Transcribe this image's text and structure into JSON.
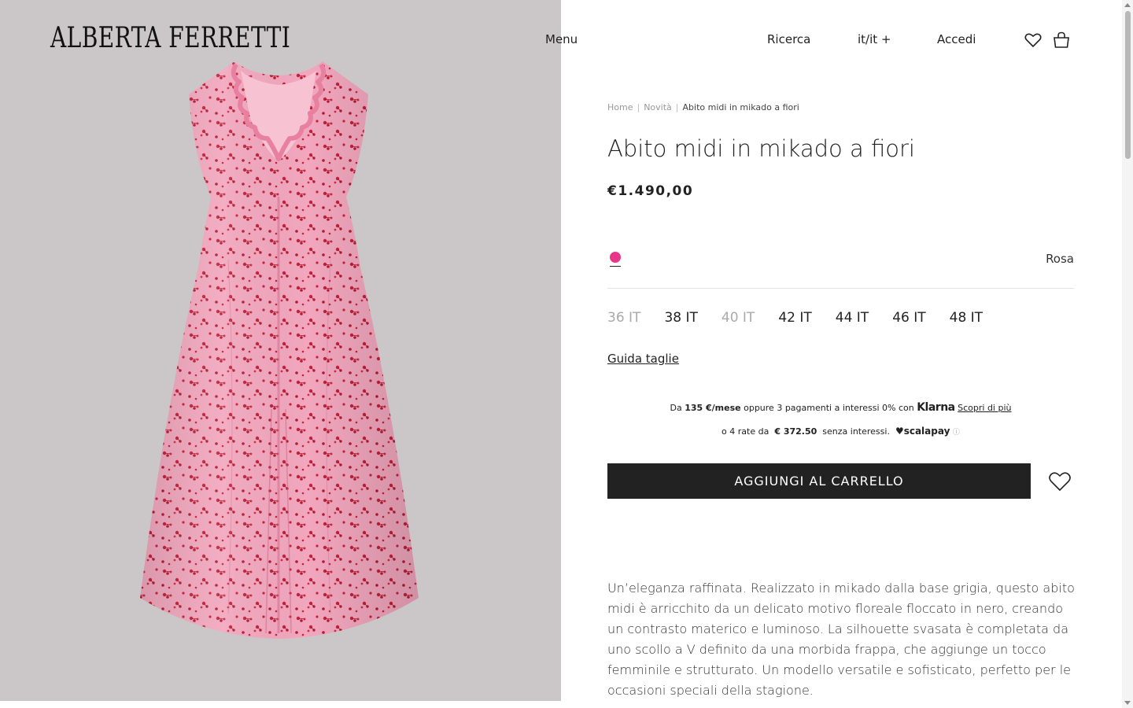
{
  "header": {
    "brand": "ALBERTA FERRETTI",
    "menu_label": "Menu",
    "search_label": "Ricerca",
    "locale_label": "it/it +",
    "login_label": "Accedi"
  },
  "breadcrumb": {
    "home": "Home",
    "category": "Novità",
    "current": "Abito midi in mikado a fiori"
  },
  "product": {
    "title": "Abito midi in mikado a fiori",
    "price": "€1.490,00",
    "color_name": "Rosa",
    "color_hex": "#e8358a",
    "sizes": [
      {
        "label": "36 IT",
        "available": false
      },
      {
        "label": "38 IT",
        "available": true
      },
      {
        "label": "40 IT",
        "available": false
      },
      {
        "label": "42 IT",
        "available": true
      },
      {
        "label": "44 IT",
        "available": true
      },
      {
        "label": "46 IT",
        "available": true
      },
      {
        "label": "48 IT",
        "available": true
      }
    ],
    "size_guide": "Guida taglie",
    "add_to_cart": "AGGIUNGI AL CARRELLO",
    "description": "Un’eleganza raffinata. Realizzato in mikado dalla base grigia, questo abito midi è arricchito da un delicato motivo floreale floccato in nero, creando un contrasto materico e luminoso. La silhouette svasata è completata da uno scollo a V definito da una morbida frappa, che aggiunge un tocco femminile e strutturato. Un modello versatile e sofisticato, perfetto per le occasioni speciali della stagione."
  },
  "payments": {
    "klarna_prefix": "Da",
    "klarna_amount": "135 €/mese",
    "klarna_text": "oppure 3 pagamenti a interessi 0% con",
    "klarna_brand": "Klarna",
    "klarna_link": "Scopri di più",
    "scalapay_prefix": "o 4 rate da",
    "scalapay_amount": "€ 372.50",
    "scalapay_text": "senza interessi.",
    "scalapay_brand": "scalapay"
  },
  "colors": {
    "image_bg": "#cbc7c8",
    "dress_pink": "#f0a0b8",
    "pattern_red": "#c8203a",
    "button_bg": "#222222"
  }
}
